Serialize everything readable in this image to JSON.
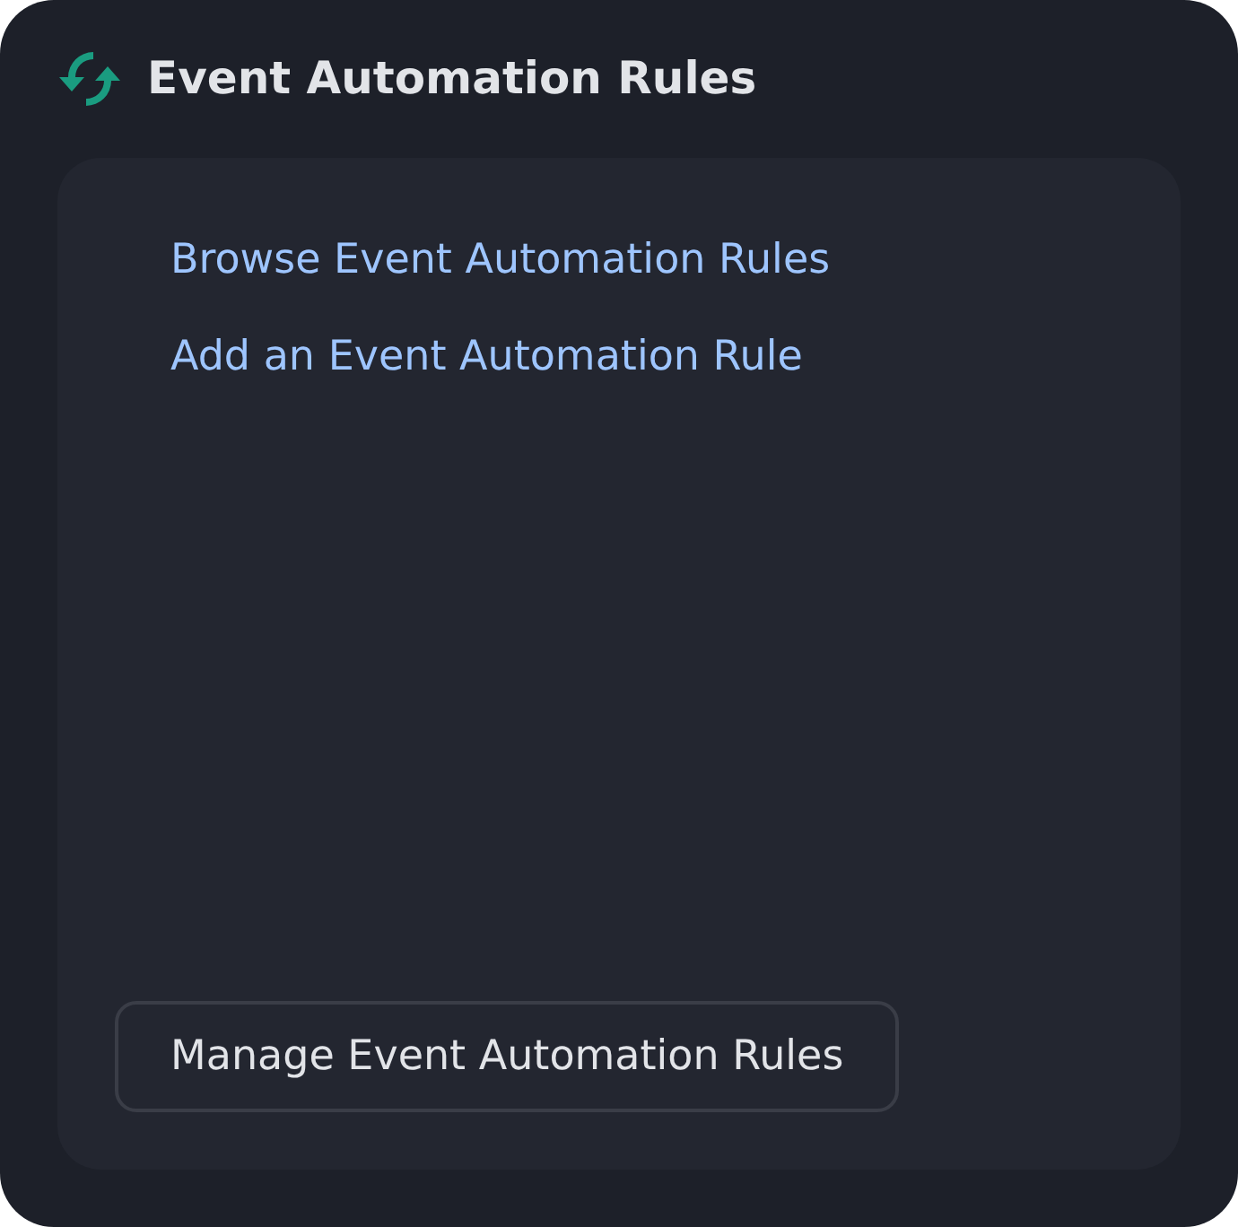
{
  "card": {
    "title": "Event Automation Rules",
    "links": [
      "Browse Event Automation Rules",
      "Add an Event Automation Rule"
    ],
    "button": "Manage Event Automation Rules"
  }
}
